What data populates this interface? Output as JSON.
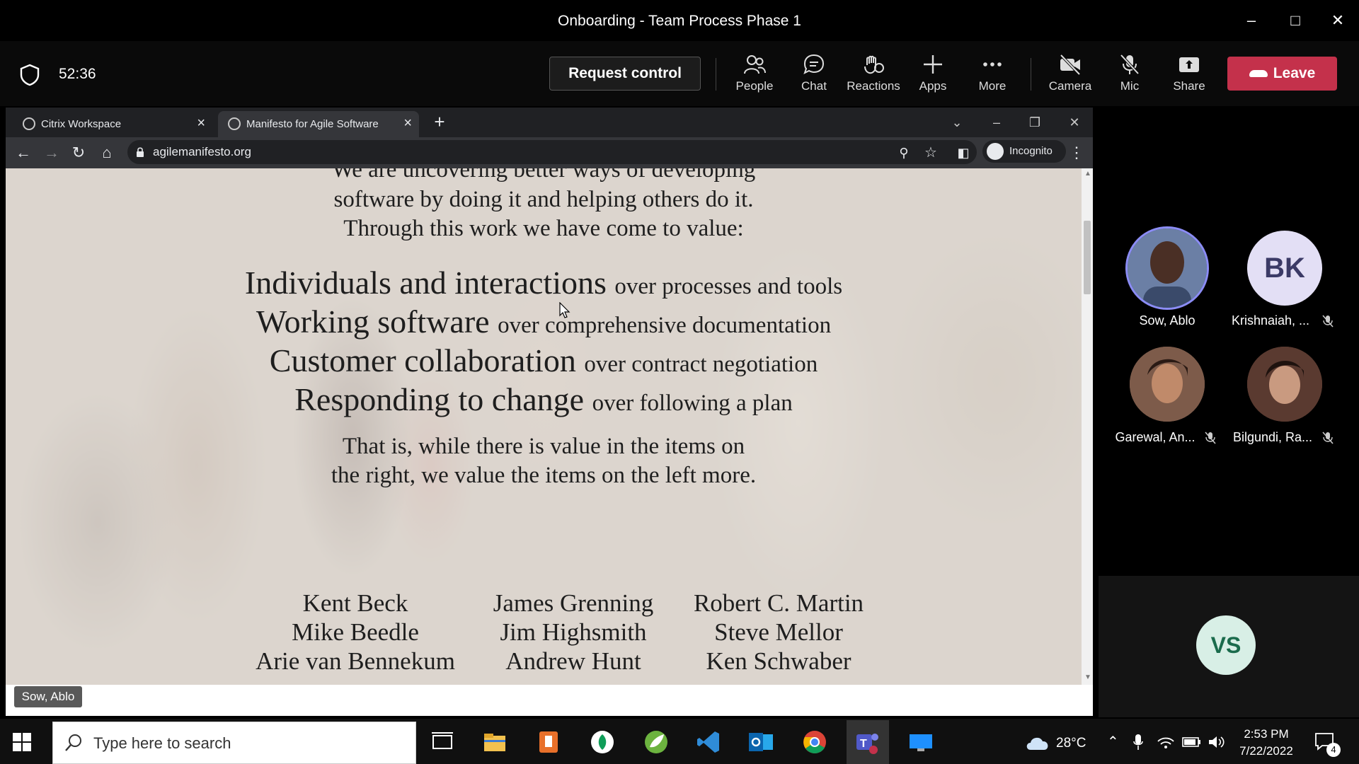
{
  "window": {
    "title": "Onboarding - Team Process Phase 1"
  },
  "meeting": {
    "timer": "52:36",
    "request_control": "Request control",
    "buttons": [
      {
        "label": "People",
        "icon": "people-icon"
      },
      {
        "label": "Chat",
        "icon": "chat-icon"
      },
      {
        "label": "Reactions",
        "icon": "reactions-icon"
      },
      {
        "label": "Apps",
        "icon": "apps-plus-icon"
      },
      {
        "label": "More",
        "icon": "more-dots-icon"
      },
      {
        "label": "Camera",
        "icon": "camera-off-icon"
      },
      {
        "label": "Mic",
        "icon": "mic-off-icon"
      },
      {
        "label": "Share",
        "icon": "share-icon"
      }
    ],
    "leave": "Leave",
    "leave_color": "#c4314b",
    "presenter_tag": "Sow, Ablo"
  },
  "browser": {
    "tabs": [
      {
        "label": "Citrix Workspace"
      },
      {
        "label": "Manifesto for Agile Software Dev"
      }
    ],
    "url": "agilemanifesto.org",
    "incognito": "Incognito"
  },
  "manifesto": {
    "intro": [
      "We are uncovering better ways of developing",
      "software by doing it and helping others do it.",
      "Through this work we have come to value:"
    ],
    "values": [
      {
        "left": "Individuals and interactions",
        "right": "over processes and tools"
      },
      {
        "left": "Working software",
        "right": "over comprehensive documentation"
      },
      {
        "left": "Customer collaboration",
        "right": "over contract negotiation"
      },
      {
        "left": "Responding to change",
        "right": "over following a plan"
      }
    ],
    "conclusion": [
      "That is, while there is value in the items on",
      "the right, we value the items on the left more."
    ],
    "signatories": [
      [
        "Kent Beck",
        "Mike Beedle",
        "Arie van Bennekum"
      ],
      [
        "James Grenning",
        "Jim Highsmith",
        "Andrew Hunt"
      ],
      [
        "Robert C. Martin",
        "Steve Mellor",
        "Ken Schwaber"
      ]
    ]
  },
  "participants": [
    {
      "name": "Sow, Ablo",
      "muted": false
    },
    {
      "name": "Krishnaiah, ...",
      "initials": "BK",
      "muted": true
    },
    {
      "name": "Garewal, An...",
      "muted": true
    },
    {
      "name": "Bilgundi, Ra...",
      "muted": true
    }
  ],
  "local_tile": {
    "initials": "VS"
  },
  "taskbar": {
    "search_placeholder": "Type here to search",
    "temperature": "28°C",
    "time": "2:53 PM",
    "date": "7/22/2022",
    "notifications": "4"
  }
}
